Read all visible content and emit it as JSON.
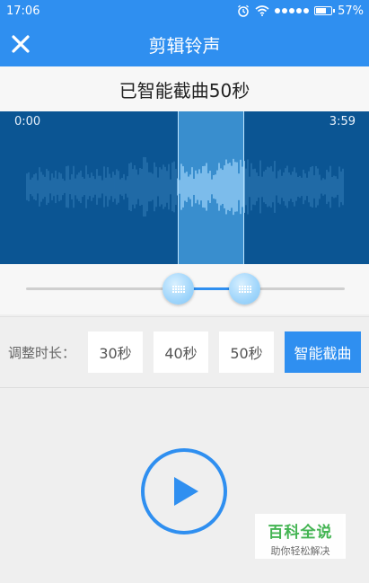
{
  "status": {
    "time": "17:06",
    "battery": "57%"
  },
  "title": "剪辑铃声",
  "info": "已智能截曲50秒",
  "waveform": {
    "start_time": "0:00",
    "end_time": "3:59"
  },
  "duration": {
    "label": "调整时长：",
    "options": [
      "30秒",
      "40秒",
      "50秒",
      "智能截曲"
    ]
  },
  "watermark": {
    "line1": "百科全说",
    "line2": "助你轻松解决"
  },
  "colors": {
    "primary": "#2f8ff0",
    "wave_bg": "#0b5593",
    "selection": "#61beff"
  }
}
